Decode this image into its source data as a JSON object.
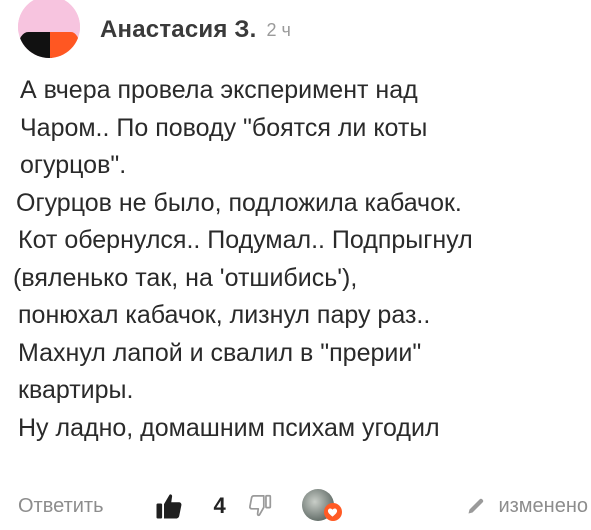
{
  "comment": {
    "author": "Анастасия З.",
    "time": "2 ч",
    "lines": [
      "А вчера провела эксперимент над",
      "Чаром.. По поводу \"боятся ли коты",
      "огурцов\".",
      "Огурцов не было, подложила кабачок.",
      "Кот обернулся.. Подумал.. Подпрыгнул",
      "(вяленько так, на 'отшибись'),",
      "понюхал кабачок, лизнул пару раз..",
      "Махнул лапой и свалил в \"прерии\"",
      "квартиры.",
      "Ну ладно, домашним психам угодил"
    ]
  },
  "footer": {
    "reply_label": "Ответить",
    "like_count": "4",
    "edited_label": "изменено"
  },
  "icons": {
    "like": "thumbs-up-icon",
    "dislike": "thumbs-down-icon",
    "heart": "heart-icon",
    "pencil": "pencil-icon"
  },
  "colors": {
    "accent": "#ff5722",
    "avatar_pink": "#f7c4df",
    "muted_text": "#8d8d8d"
  }
}
